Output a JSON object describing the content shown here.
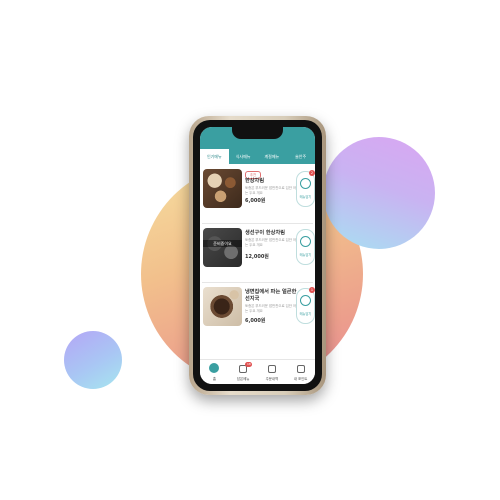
{
  "tabs": [
    "인기메뉴",
    "식사메뉴",
    "계절메뉴",
    "술안주"
  ],
  "items": [
    {
      "badge": "추천",
      "title": "한상차림",
      "desc": "토종은 부드러운 밥반찬으로\n입안 어는 두요 개요",
      "price": "6,000원",
      "action": "메뉴담기",
      "count": "2"
    },
    {
      "overlay": "준비중이요",
      "title": "생선구이 한상차림",
      "desc": "토종은 부드러운 밥반찬으로\n입안 어는 두요 개요",
      "price": "12,000원",
      "action": "메뉴담기"
    },
    {
      "title": "냉면집에서 파는 얼큰한 선지국",
      "desc": "토종은 부드러운 밥반찬으로\n입안 어는 두요 개요",
      "price": "6,000원",
      "action": "메뉴담기",
      "count": "1"
    }
  ],
  "bottom_nav": [
    {
      "label": "홈",
      "icon": "home-icon"
    },
    {
      "label": "담은메뉴",
      "icon": "cart-icon",
      "badge": "18"
    },
    {
      "label": "주문내역",
      "icon": "receipt-icon"
    },
    {
      "label": "내 포인트",
      "icon": "point-icon"
    }
  ],
  "colors": {
    "accent": "#3a9fa1",
    "alert": "#e05050"
  }
}
